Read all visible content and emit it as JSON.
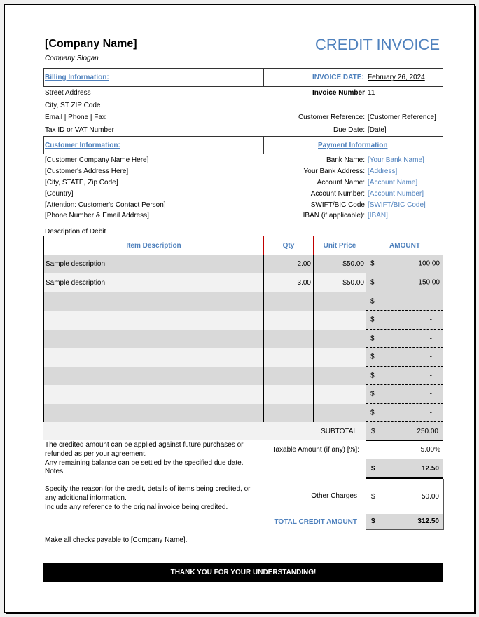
{
  "header": {
    "company_name": "[Company Name]",
    "company_slogan": "Company Slogan",
    "title": "CREDIT INVOICE"
  },
  "billing": {
    "heading": "Billing Information:",
    "lines": [
      "Street Address",
      "City, ST  ZIP Code",
      "Email | Phone | Fax",
      "Tax ID or VAT Number"
    ]
  },
  "invoice_meta": {
    "date_label": "INVOICE DATE:",
    "date_value": "February 26, 2024",
    "number_label": "Invoice Number",
    "number_value": "11",
    "customer_ref_label": "Customer Reference:",
    "customer_ref_value": "[Customer Reference]",
    "due_date_label": "Due Date:",
    "due_date_value": "[Date]"
  },
  "customer": {
    "heading": "Customer Information:",
    "lines": [
      "[Customer Company Name Here]",
      "[Customer's Address Here]",
      "[City, STATE, Zip Code]",
      "[Country]",
      "[Attention: Customer's Contact Person]",
      "[Phone Number & Email Address]"
    ]
  },
  "payment": {
    "heading": "Payment Information",
    "fields": [
      {
        "label": "Bank Name:",
        "value": "[Your Bank Name]"
      },
      {
        "label": "Your Bank Address:",
        "value": "[Address]"
      },
      {
        "label": "Account Name:",
        "value": "[Account Name]"
      },
      {
        "label": "Account Number:",
        "value": "[Account Number]"
      },
      {
        "label": "SWIFT/BIC Code",
        "value": "[SWIFT/BIC Code]"
      },
      {
        "label": "IBAN (if applicable):",
        "value": "[IBAN]"
      }
    ]
  },
  "table": {
    "caption": "Description of Debit",
    "headers": [
      "Item Description",
      "Qty",
      "Unit Price",
      "AMOUNT"
    ],
    "currency": "$",
    "rows": [
      {
        "desc": "Sample description",
        "qty": "2.00",
        "price": "$50.00",
        "amount": "100.00"
      },
      {
        "desc": "Sample description",
        "qty": "3.00",
        "price": "$50.00",
        "amount": "150.00"
      },
      {
        "desc": "",
        "qty": "",
        "price": "",
        "amount": "-"
      },
      {
        "desc": "",
        "qty": "",
        "price": "",
        "amount": "-"
      },
      {
        "desc": "",
        "qty": "",
        "price": "",
        "amount": "-"
      },
      {
        "desc": "",
        "qty": "",
        "price": "",
        "amount": "-"
      },
      {
        "desc": "",
        "qty": "",
        "price": "",
        "amount": "-"
      },
      {
        "desc": "",
        "qty": "",
        "price": "",
        "amount": "-"
      },
      {
        "desc": "",
        "qty": "",
        "price": "",
        "amount": "-"
      }
    ]
  },
  "totals": {
    "subtotal_label": "SUBTOTAL",
    "subtotal_value": "250.00",
    "tax_label": "Taxable Amount (if any) [%]:",
    "tax_rate": "5.00%",
    "tax_value": "12.50",
    "other_label": "Other Charges",
    "other_value": "50.00",
    "total_label": "TOTAL CREDIT AMOUNT",
    "total_value": "312.50"
  },
  "notes": {
    "p1_l1": "The credited amount can be applied against future purchases or",
    "p1_l2": "refunded as per your agreement.",
    "p1_l3": "Any remaining balance can be settled by the specified due date.",
    "p1_l4": "Notes:",
    "p2_l1": "Specify the reason for the credit, details of items being credited, or",
    "p2_l2": "any additional information.",
    "p2_l3": "Include any reference to the original invoice being credited.",
    "checks": "Make all checks payable to [Company Name]."
  },
  "footer": {
    "banner": "THANK YOU FOR YOUR UNDERSTANDING!"
  }
}
